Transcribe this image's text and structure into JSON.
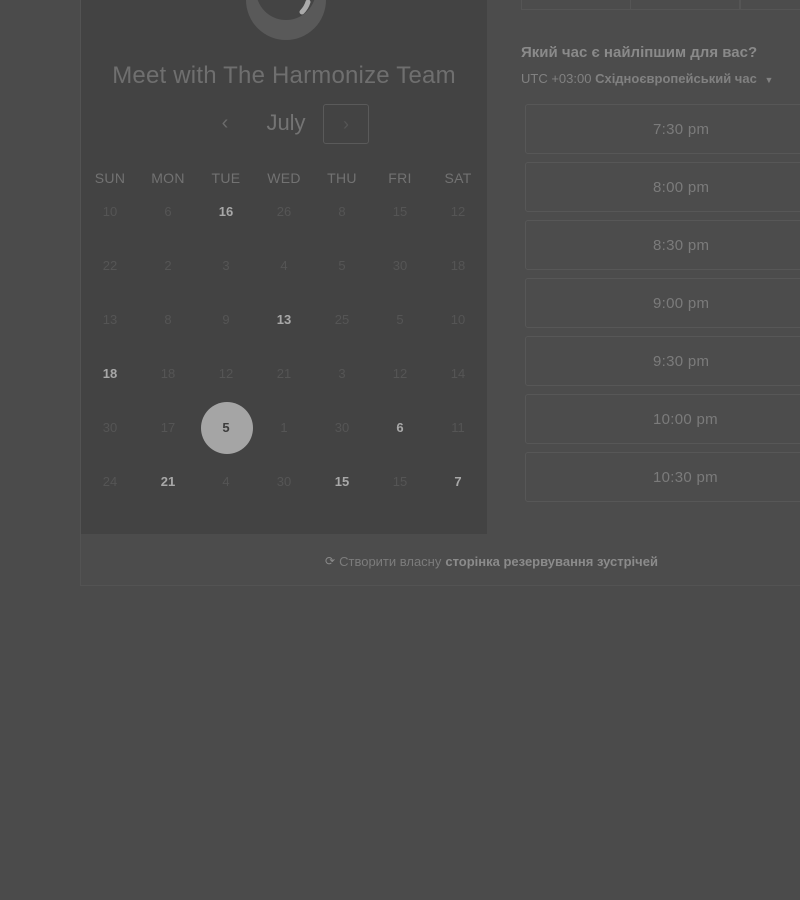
{
  "header": {
    "title": "Meet with The Harmonize Team"
  },
  "calendar": {
    "month": "July",
    "prev_icon": "‹",
    "next_icon": "›",
    "weekdays": [
      "SUN",
      "MON",
      "TUE",
      "WED",
      "THU",
      "FRI",
      "SAT"
    ],
    "rows": [
      [
        "10",
        "6",
        "16",
        "26",
        "8",
        "15",
        "12"
      ],
      [
        "22",
        "2",
        "3",
        "4",
        "5",
        "30",
        "18"
      ],
      [
        "13",
        "8",
        "9",
        "13",
        "25",
        "5",
        "10"
      ],
      [
        "18",
        "18",
        "12",
        "21",
        "3",
        "12",
        "14"
      ],
      [
        "30",
        "17",
        "5",
        "1",
        "30",
        "6",
        "11"
      ],
      [
        "24",
        "21",
        "4",
        "30",
        "15",
        "15",
        "7"
      ]
    ],
    "active_cells": [
      "0-2",
      "2-3",
      "3-0",
      "4-5",
      "5-1",
      "5-4",
      "5-6"
    ],
    "selected_cell": "4-2"
  },
  "times": {
    "question": "Який час є найліпшим для вас?",
    "timezone_offset": "UTC +03:00",
    "timezone_name": "Східноєвропейський час",
    "slots": [
      "7:30 pm",
      "8:00 pm",
      "8:30 pm",
      "9:00 pm",
      "9:30 pm",
      "10:00 pm",
      "10:30 pm"
    ]
  },
  "footer": {
    "prefix": "Створити власну",
    "link": "сторінка резервування зустрічей"
  }
}
